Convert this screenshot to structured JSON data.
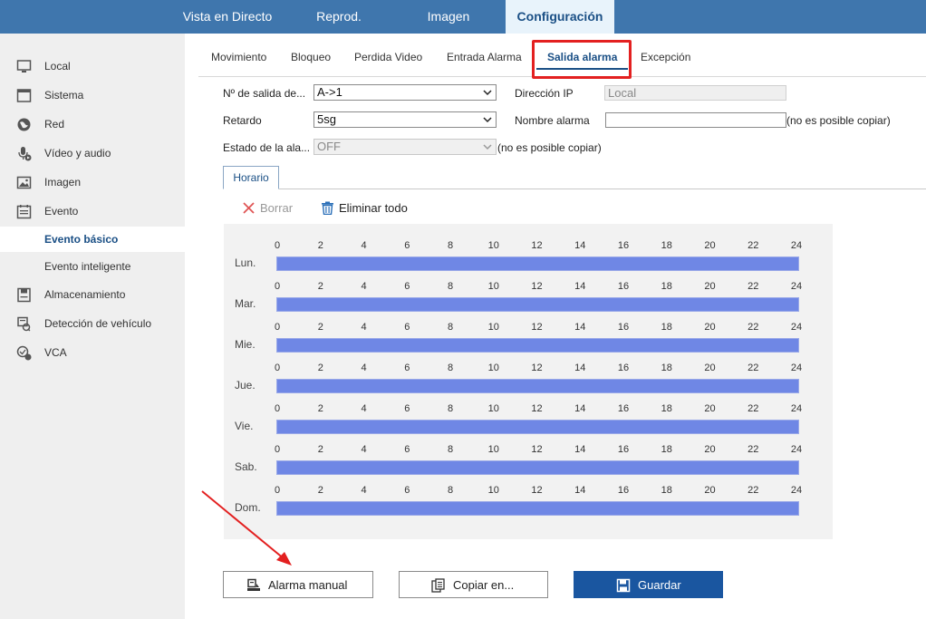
{
  "topnav": {
    "items": [
      {
        "label": "Vista en Directo"
      },
      {
        "label": "Reprod."
      },
      {
        "label": "Imagen"
      },
      {
        "label": "Configuración",
        "active": true
      }
    ]
  },
  "sidebar": {
    "items": [
      {
        "label": "Local",
        "icon": "monitor-icon"
      },
      {
        "label": "Sistema",
        "icon": "window-icon"
      },
      {
        "label": "Red",
        "icon": "globe-icon"
      },
      {
        "label": "Vídeo y audio",
        "icon": "microphone-icon"
      },
      {
        "label": "Imagen",
        "icon": "image-icon"
      },
      {
        "label": "Evento",
        "icon": "calendar-icon"
      },
      {
        "label": "Evento básico",
        "active": true
      },
      {
        "label": "Evento inteligente"
      },
      {
        "label": "Almacenamiento",
        "icon": "storage-icon"
      },
      {
        "label": "Detección de vehículo",
        "icon": "vehicle-detection-icon"
      },
      {
        "label": "VCA",
        "icon": "vca-icon"
      }
    ]
  },
  "tabs": [
    {
      "label": "Movimiento"
    },
    {
      "label": "Bloqueo"
    },
    {
      "label": "Perdida Video"
    },
    {
      "label": "Entrada Alarma"
    },
    {
      "label": "Salida alarma",
      "active": true
    },
    {
      "label": "Excepción"
    }
  ],
  "form": {
    "output_no_label": "Nº de salida de...",
    "output_no_value": "A->1",
    "ip_label": "Dirección IP",
    "ip_value": "Local",
    "delay_label": "Retardo",
    "delay_value": "5sg",
    "alarm_name_label": "Nombre alarma",
    "alarm_name_value": "",
    "alarm_name_note": "(no es posible copiar)",
    "alarm_state_label": "Estado de la ala...",
    "alarm_state_value": "OFF",
    "alarm_state_note": "(no es posible copiar)"
  },
  "schedule": {
    "tab_label": "Horario",
    "delete_label": "Borrar",
    "delete_all_label": "Eliminar todo",
    "ticks": [
      "0",
      "2",
      "4",
      "6",
      "8",
      "10",
      "12",
      "14",
      "16",
      "18",
      "20",
      "22",
      "24"
    ],
    "days": [
      {
        "label": "Lun.",
        "start": 0,
        "end": 24
      },
      {
        "label": "Mar.",
        "start": 0,
        "end": 24
      },
      {
        "label": "Mie.",
        "start": 0,
        "end": 24
      },
      {
        "label": "Jue.",
        "start": 0,
        "end": 24
      },
      {
        "label": "Vie.",
        "start": 0,
        "end": 24
      },
      {
        "label": "Sab.",
        "start": 0,
        "end": 24
      },
      {
        "label": "Dom.",
        "start": 0,
        "end": 24
      }
    ],
    "bar_color": "#6f87e5"
  },
  "buttons": {
    "manual_alarm": "Alarma manual",
    "copy_to": "Copiar en...",
    "save": "Guardar"
  },
  "colors": {
    "nav_bg": "#3f76ad",
    "accent": "#1a4f85",
    "highlight": "#e32020"
  }
}
